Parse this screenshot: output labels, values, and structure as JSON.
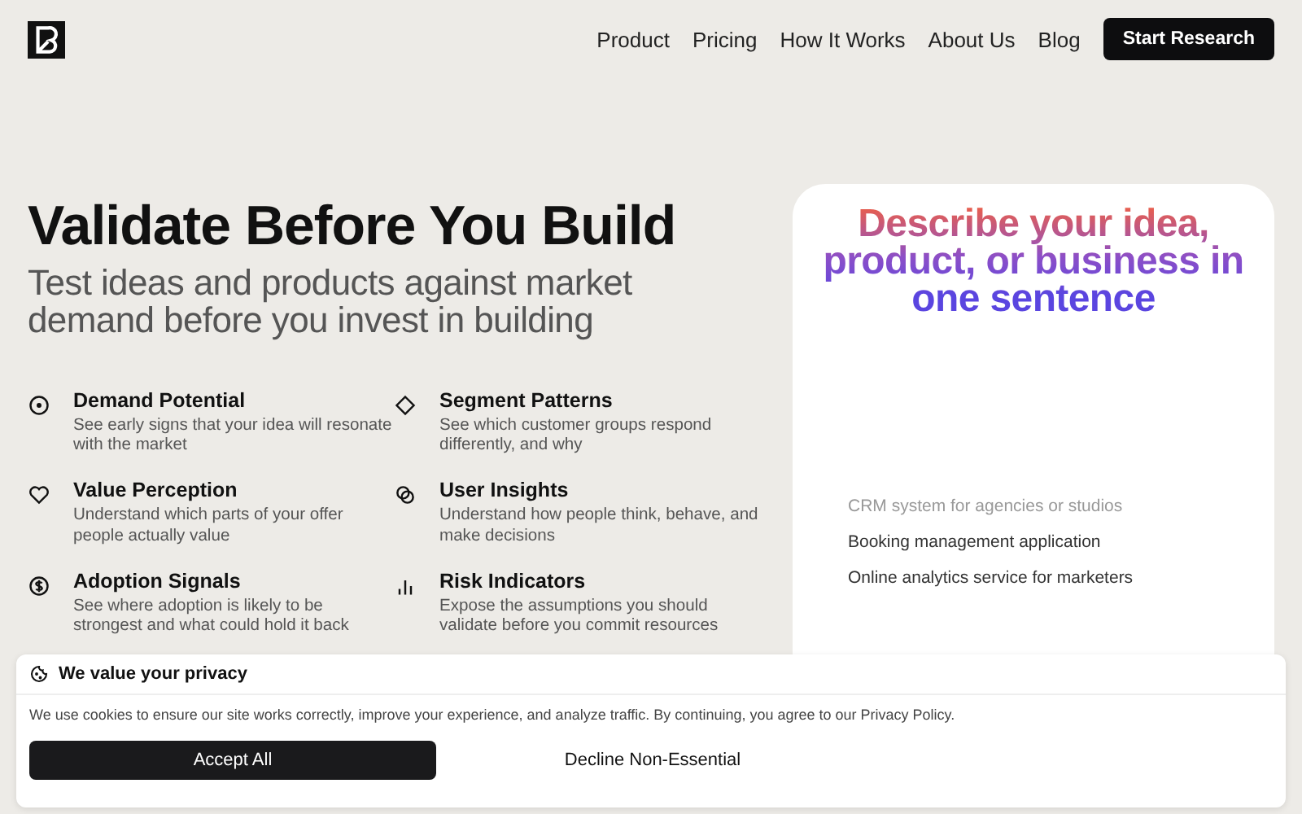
{
  "nav": {
    "links": [
      "Product",
      "Pricing",
      "How It Works",
      "About Us",
      "Blog"
    ],
    "cta": "Start Research"
  },
  "hero": {
    "title": "Validate Before You Build",
    "subtitle": "Test ideas and products against market demand before you invest in building"
  },
  "features": [
    {
      "kind": "target",
      "title": "Demand Potential",
      "text": "See early signs that your idea will resonate with the market"
    },
    {
      "kind": "diamond",
      "title": "Segment Patterns",
      "text": "See which customer groups respond differently, and why"
    },
    {
      "kind": "heart",
      "title": "Value Perception",
      "text": "Understand which parts of your offer people actually value"
    },
    {
      "kind": "circles",
      "title": "User Insights",
      "text": "Understand how people think, behave, and make decisions"
    },
    {
      "kind": "dollar",
      "title": "Adoption Signals",
      "text": "See where adoption is likely to be strongest and what could hold it back"
    },
    {
      "kind": "bars",
      "title": "Risk Indicators",
      "text": "Expose the assumptions you should validate before you commit resources"
    }
  ],
  "idea_card": {
    "heading": "Describe your idea, product, or business in one sentence",
    "examples": [
      {
        "text": "CRM system for agencies or studios",
        "selected": false
      },
      {
        "text": "Booking management application",
        "selected": true
      },
      {
        "text": "Online analytics service for marketers",
        "selected": true
      }
    ]
  },
  "cookie_banner": {
    "title": "We value your privacy",
    "text": "We use cookies to ensure our site works correctly, improve your experience, and analyze traffic. By continuing, you agree to our Privacy Policy.",
    "accept": "Accept All",
    "decline": "Decline Non-Essential"
  }
}
